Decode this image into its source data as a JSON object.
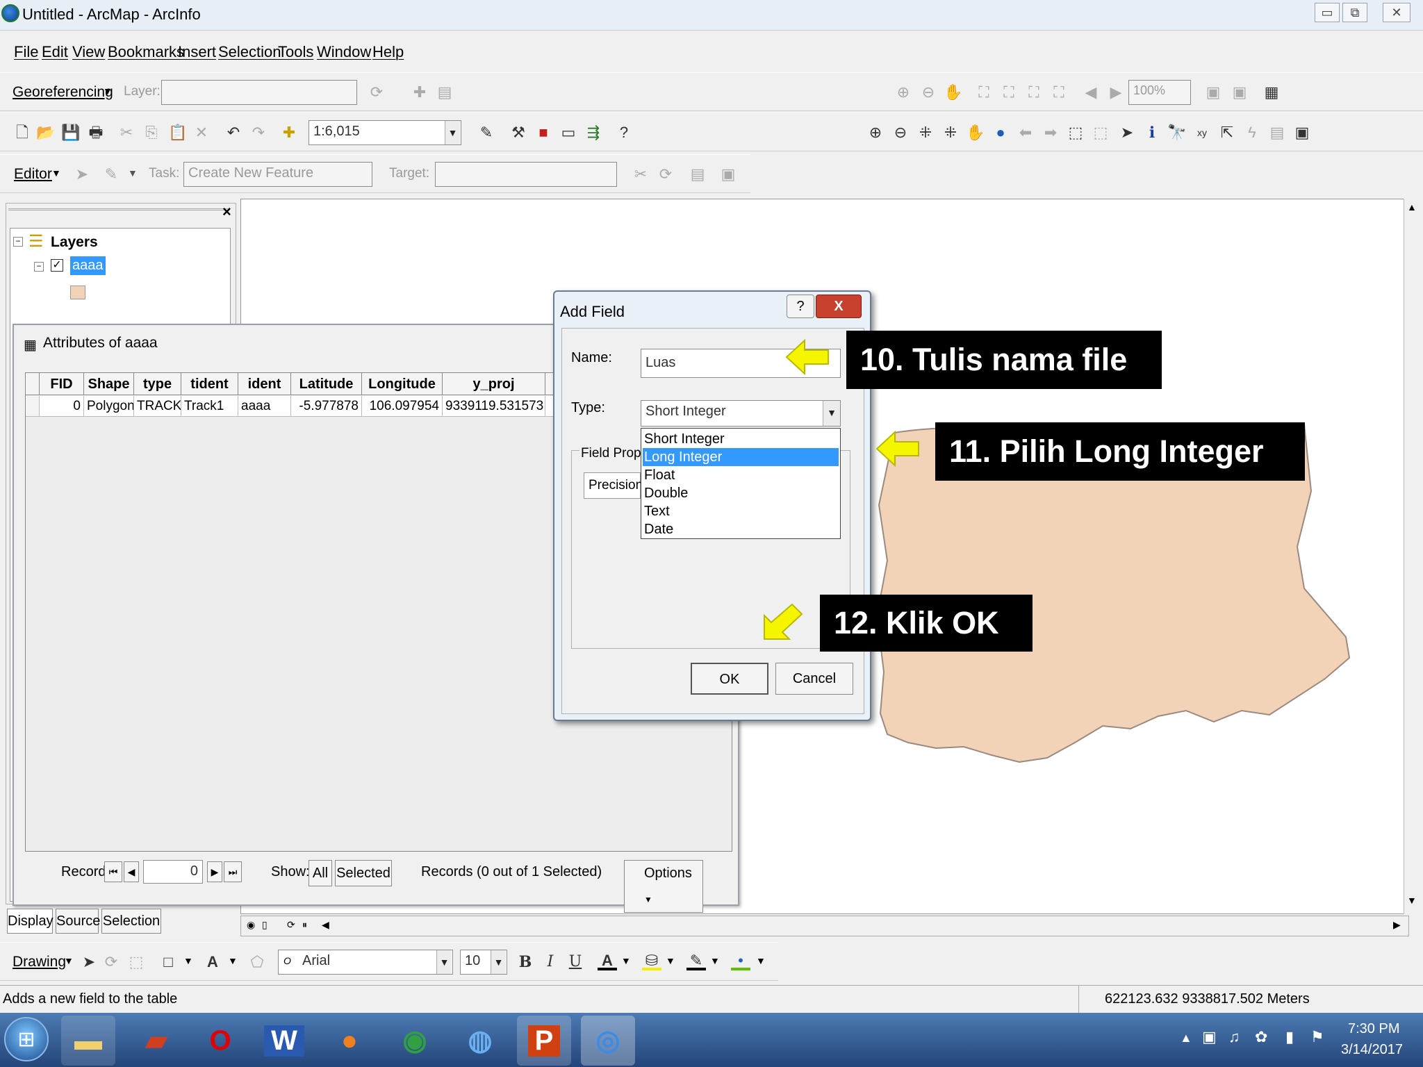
{
  "window": {
    "title": "Untitled - ArcMap - ArcInfo",
    "min": "▭",
    "max": "⧉",
    "close": "✕"
  },
  "menu": [
    "File",
    "Edit",
    "View",
    "Bookmarks",
    "Insert",
    "Selection",
    "Tools",
    "Window",
    "Help"
  ],
  "georef": {
    "label": "Georeferencing",
    "layer_label": "Layer:",
    "zoom": "100%"
  },
  "standard": {
    "scale": "1:6,015"
  },
  "editor": {
    "label": "Editor",
    "task_label": "Task:",
    "task_value": "Create New Feature",
    "target_label": "Target:"
  },
  "toc": {
    "root": "Layers",
    "layer": "aaaa",
    "close": "×"
  },
  "attr": {
    "title": "Attributes of aaaa",
    "columns": [
      "FID",
      "Shape",
      "type",
      "tident",
      "ident",
      "Latitude",
      "Longitude",
      "y_proj"
    ],
    "rows": [
      [
        "0",
        "Polygon",
        "TRACK",
        "Track1",
        "aaaa",
        "-5.977878",
        "106.097954",
        "9339119.531573"
      ]
    ],
    "record_label": "Record:",
    "record_value": "0",
    "show_label": "Show:",
    "all": "All",
    "selected": "Selected",
    "records_text": "Records (0 out of 1 Selected)",
    "options": "Options"
  },
  "dialog": {
    "title": "Add Field",
    "help": "?",
    "close": "X",
    "name_label": "Name:",
    "name_value": "Luas",
    "type_label": "Type:",
    "type_value": "Short Integer",
    "props_label": "Field Proper",
    "precision_label": "Precision",
    "options": [
      "Short Integer",
      "Long Integer",
      "Float",
      "Double",
      "Text",
      "Date"
    ],
    "selected_option": "Long Integer",
    "ok": "OK",
    "cancel": "Cancel"
  },
  "callouts": {
    "c10": "10. Tulis nama file",
    "c11": "11. Pilih Long Integer",
    "c12": "12. Klik OK"
  },
  "bottom_tabs": [
    "Display",
    "Source",
    "Selection"
  ],
  "drawing": {
    "label": "Drawing",
    "font": "Arial",
    "size": "10",
    "bold": "B",
    "italic": "I",
    "underline": "U"
  },
  "status": {
    "message": "Adds a new field to the table",
    "coords": "622123.632  9338817.502 Meters"
  },
  "clock": {
    "time": "7:30 PM",
    "date": "3/14/2017"
  },
  "colors": {
    "polygon": "#f2d3b7",
    "callout_bg": "#000000",
    "arrow": "#f5f500",
    "highlight": "#3399ff"
  }
}
